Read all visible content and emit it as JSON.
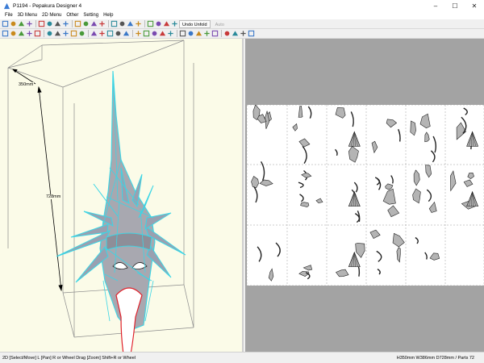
{
  "window": {
    "title": "P1194 - Pepakura Designer 4",
    "controls": {
      "minimize": "–",
      "maximize": "☐",
      "close": "✕"
    }
  },
  "menu": [
    "File",
    "3D Menu",
    "2D Menu",
    "Other",
    "Setting",
    "Help"
  ],
  "toolbar1": {
    "icons": [
      "open-icon",
      "save-icon",
      "print-icon",
      "select-icon",
      "move-icon",
      "rotate-icon",
      "zoom-icon",
      "texture-icon",
      "edit-icon",
      "fill-icon",
      "dimension-icon",
      "pdf-icon",
      "cut-icon",
      "paste-icon",
      "join-icon",
      "arrow-icon",
      "split-icon",
      "frame-icon",
      "view-split-icon",
      "view-single-icon"
    ],
    "undo_unfold": "Undo Unfold",
    "auto": "Auto"
  },
  "toolbar2": {
    "icons": [
      "select-3d-icon",
      "zoom-3d-icon",
      "pan-icon",
      "draw-icon",
      "line-icon",
      "face-icon",
      "cube-icon",
      "shape-icon",
      "plane-icon",
      "grid-icon",
      "edge-icon",
      "mirror-icon",
      "part-icon",
      "rotate-part-icon",
      "flip-icon",
      "group-icon",
      "tab-icon",
      "label-icon",
      "scale-icon",
      "lock-icon",
      "align-left-icon",
      "align-center-icon",
      "align-right-icon",
      "arrange-icon",
      "page-icon",
      "join-page-icon",
      "fit-icon",
      "full-icon",
      "export-icon"
    ]
  },
  "view3d": {
    "dimensions": {
      "width": "350mm",
      "height": "728mm"
    }
  },
  "status": {
    "left": "2D [Select/Move] L [Pan] R or Wheel Drag [Zoom] Shift+R or Wheel",
    "right": "H350mm W386mm D728mm / Parts 72"
  },
  "colors": {
    "mesh_fill": "#a8a8b0",
    "mesh_edge": "#3bd6e6",
    "cut_line": "#e0202a",
    "panel_bg": "#fbfbe8",
    "sheet_bg": "#ffffff",
    "workspace": "#a3a3a3"
  }
}
